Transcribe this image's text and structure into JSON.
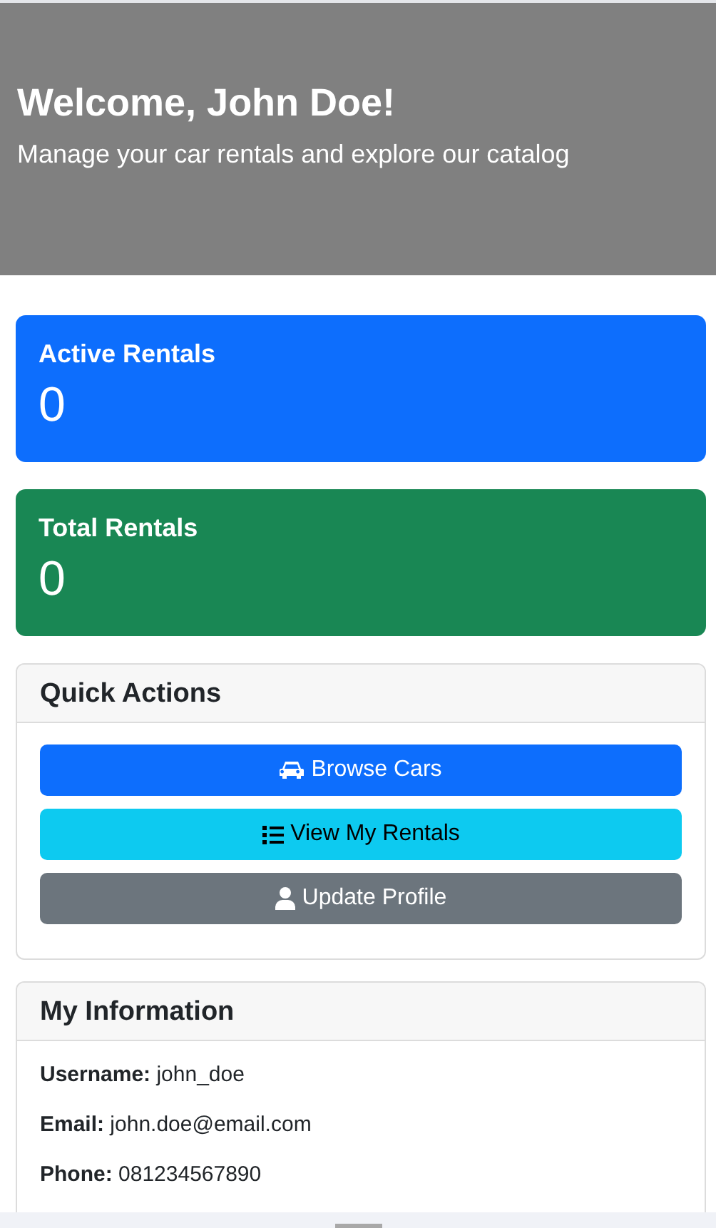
{
  "hero": {
    "title": "Welcome, John Doe!",
    "subtitle": "Manage your car rentals and explore our catalog"
  },
  "stats": [
    {
      "label": "Active Rentals",
      "value": "0",
      "color": "#0d6efd"
    },
    {
      "label": "Total Rentals",
      "value": "0",
      "color": "#198754"
    }
  ],
  "quick_actions": {
    "title": "Quick Actions",
    "buttons": [
      {
        "label": "Browse Cars",
        "kind": "browse"
      },
      {
        "label": "View My Rentals",
        "kind": "rentals"
      },
      {
        "label": "Update Profile",
        "kind": "profile"
      }
    ]
  },
  "my_information": {
    "title": "My Information",
    "lines": [
      "**Username:** john_doe",
      "**Email:** john.doe@email.com",
      "**Phone:** 081234567890"
    ]
  }
}
